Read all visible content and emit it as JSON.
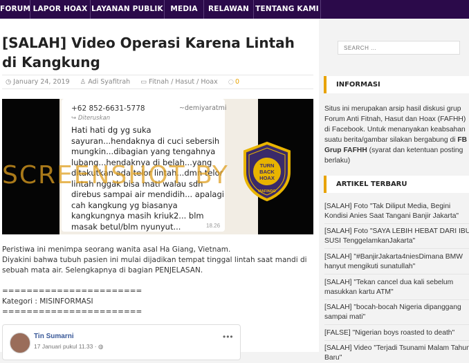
{
  "nav": {
    "items": [
      "FORUM",
      "LAPOR HOAX",
      "LAYANAN PUBLIK",
      "MEDIA",
      "RELAWAN",
      "TENTANG KAMI"
    ]
  },
  "article": {
    "title": "[SALAH] Video Operasi Karena Lintah di Kangkung",
    "date": "January 24, 2019",
    "author": "Adi Syafitrah",
    "categories": "Fitnah / Hasut / Hoax",
    "comments": "0",
    "image": {
      "phone_number": "+62 852-6631-5778",
      "sender_name": "~demiyaratmi",
      "forwarded": "Diteruskan",
      "message": "Hati hati dg yg suka sayuran...hendaknya di cuci sebersih mungkin...dibagian yang tengahnya lubang...hendaknya di belah...yang ditakutkan ada telor lintah...dmn telor lintah nggak bisa mati walau sdh direbus sampai air mendidih... apalagi cah kangkung yg biasanya kangkungnya masih kriuk2... blm masak betul/blm nyunyut...",
      "time": "18.26",
      "watermark": "SCREENSHOT BY",
      "badge_text_top": "TURN",
      "badge_text_mid": "BACK",
      "badge_text_bot": "HOAX",
      "badge_ring": "MASYARAKAT ANTI FITNAH INDONESIA",
      "badge_footer": "MAFINDO"
    },
    "body": [
      "Peristiwa ini menimpa seorang wanita asal Ha Giang, Vietnam.",
      "Diyakini bahwa tubuh pasien ini mulai dijadikan tempat tinggal lintah saat mandi di sebuah mata air. Selengkapnya di bagian PENJELASAN.",
      "=======================",
      "Kategori : MISINFORMASI",
      "======================="
    ],
    "embed": {
      "name": "Tin Sumarni",
      "date": "17 Januari pukul 11.33 · "
    }
  },
  "sidebar": {
    "search_placeholder": "SEARCH ...",
    "info_title": "INFORMASI",
    "info_text_1": "Situs ini merupakan arsip hasil diskusi grup Forum Anti Fitnah, Hasut dan Hoax (FAFHH) di Facebook. Untuk menanyakan keabsahan suatu berita/gambar silakan bergabung di ",
    "info_text_bold": "FB Grup FAFHH",
    "info_text_2": " (syarat dan ketentuan posting berlaku)",
    "recent_title": "ARTIKEL TERBARU",
    "recent": [
      "[SALAH] Foto \"Tak Diliput Media, Begini Kondisi Anies Saat Tangani Banjir Jakarta\"",
      "[SALAH] Foto \"SAYA LEBIH HEBAT DARI IBU SUSI TenggelamkanJakarta\"",
      "[SALAH] \"#BanjirJakarta4niesDimana BMW hanyut mengikuti sunatullah\"",
      "[SALAH] \"Tekan cancel dua kali sebelum masukkan kartu ATM\"",
      "[SALAH] \"bocah-bocah Nigeria dipanggang sampai mati\"",
      "[FALSE] \"Nigerian boys roasted to death\"",
      "[SALAH] Video \"Terjadi Tsunami Malam Tahun Baru\""
    ]
  },
  "colors": {
    "nav_bg": "#2b0a4a",
    "accent": "#e8a300",
    "link": "#385898"
  }
}
